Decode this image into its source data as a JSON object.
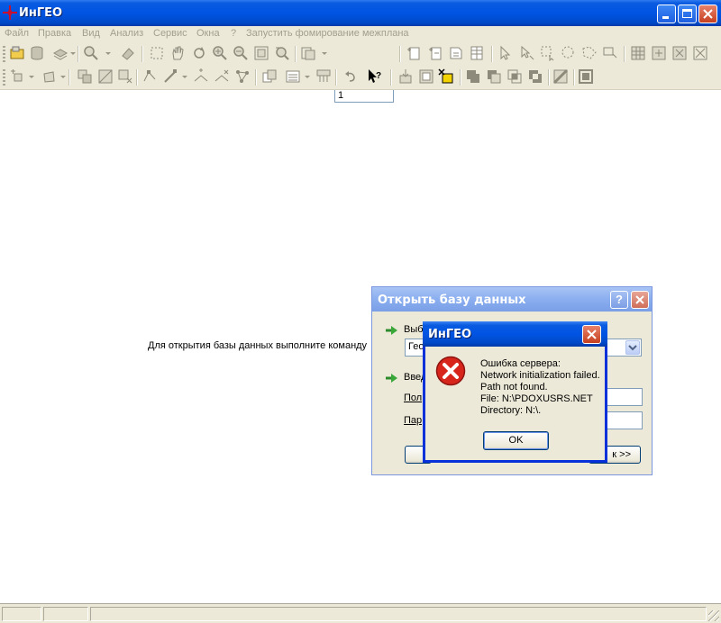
{
  "window": {
    "title": "ИнГЕО",
    "controls": [
      "minimize-icon",
      "maximize-icon",
      "close-icon"
    ]
  },
  "menu": {
    "items": [
      {
        "label": "Файл"
      },
      {
        "label": "Правка"
      },
      {
        "label": "Вид"
      },
      {
        "label": "Анализ"
      },
      {
        "label": "Сервис"
      },
      {
        "label": "Окна"
      },
      {
        "label": "?"
      },
      {
        "label": "Запустить фомирование межплана"
      }
    ]
  },
  "toolbar": {
    "scale_value": "1"
  },
  "workspace": {
    "hint": "Для открытия базы данных выполните команду"
  },
  "open_db_dialog": {
    "title": "Открыть базу данных",
    "help_glyph": "?",
    "select_label": "Выб",
    "select_value": "Гео",
    "enter_label": "Введ",
    "user_label": "Пол",
    "password_label": "Пар",
    "next_button_label": "к >>"
  },
  "error_dialog": {
    "title": "ИнГЕО",
    "lines": [
      "Ошибка сервера:",
      "Network initialization failed.",
      "Path not found.",
      "File: N:\\PDOXUSRS.NET",
      "Directory: N:\\."
    ],
    "ok_label": "OK"
  },
  "colors": {
    "title_bar": "#0054e3",
    "inactive_title_bar": "#8aaeef",
    "chrome": "#ece9d8",
    "error_icon": "#d8251b"
  }
}
